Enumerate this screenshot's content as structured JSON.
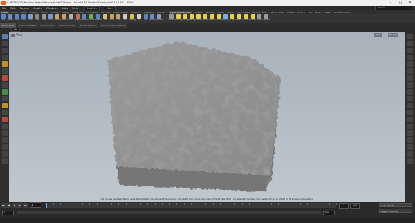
{
  "window": {
    "title": "C:/WORK/GIS/Houdini Projects/bricks/bricks01.hipnc - Houdini FX Limited Commercial 19.5.467 - FyTri",
    "controls": {
      "minimize": "–",
      "maximize": "□",
      "close": "✕"
    }
  },
  "menubar": {
    "items": [
      "File",
      "Edit",
      "Render",
      "Assets",
      "Windows",
      "Labs",
      "Help"
    ],
    "desktop": "Modeler",
    "build": "Main",
    "search_placeholder": "Search"
  },
  "shelf_tabs_left": [
    "Create",
    "Modify",
    "Model",
    "Polygon",
    "Deform",
    "Texture",
    "Rigging",
    "Characters",
    "Constraints",
    "Hair Utils",
    "Guide Process",
    "Terrain FX",
    "Simple FX",
    "Volume"
  ],
  "shelf_tabs_right": [
    "Lights and Cameras",
    "Collisions",
    "Particles",
    "Grains",
    "Vellum",
    "Rigid Bodies",
    "Particle Fluids",
    "Viscous Fluids",
    "Oceans",
    "Pyro FX",
    "FEM",
    "Wires",
    "Crowds",
    "Drive Simulation"
  ],
  "shelf_tools_left": [
    {
      "label": "Box",
      "icon": "box-icon",
      "color": "#5d86c5"
    },
    {
      "label": "Sphere",
      "icon": "sphere-icon",
      "color": "#6b8fc9"
    },
    {
      "label": "Tube",
      "icon": "tube-icon",
      "color": "#5d86c5"
    },
    {
      "label": "Torus",
      "icon": "torus-icon",
      "color": "#5d86c5"
    },
    {
      "label": "Grid",
      "icon": "grid-icon",
      "color": "#7a9ac9"
    },
    {
      "label": "Null",
      "icon": "null-icon",
      "color": "#8a8a8a"
    },
    {
      "label": "Line",
      "icon": "line-icon",
      "color": "#9a9a9a"
    },
    {
      "label": "Circle",
      "icon": "circle-icon",
      "color": "#7a9ac9"
    },
    {
      "label": "Curve Bezier",
      "icon": "curve-icon",
      "color": "#c9a35d"
    },
    {
      "label": "Draw Curve",
      "icon": "draw-curve-icon",
      "color": "#c9a35d"
    },
    {
      "label": "Path",
      "icon": "path-icon",
      "color": "#b0b0b0"
    },
    {
      "label": "Spray Paint",
      "icon": "spray-icon",
      "color": "#c96b5d"
    },
    {
      "label": "Platonic Solids",
      "icon": "platonic-icon",
      "color": "#5d86c5"
    },
    {
      "label": "L-System",
      "icon": "lsystem-icon",
      "color": "#6bb05d"
    },
    {
      "label": "Metaball",
      "icon": "metaball-icon",
      "color": "#5d86c5"
    },
    {
      "label": "File",
      "icon": "file-icon",
      "color": "#d9c07a"
    },
    {
      "label": "Spiral",
      "icon": "spiral-icon",
      "color": "#c9a35d"
    },
    {
      "label": "Helix",
      "icon": "helix-icon",
      "color": "#c9a35d"
    },
    {
      "label": "Font",
      "icon": "font-icon",
      "color": "#cccccc"
    },
    {
      "label": "Lighting",
      "icon": "lighting-icon",
      "color": "#e0c24a"
    },
    {
      "label": "Fill",
      "icon": "fill-icon",
      "color": "#d0d0d0"
    },
    {
      "label": "Skin",
      "icon": "skin-icon",
      "color": "#5d86c5"
    },
    {
      "label": "Smooth",
      "icon": "smooth-icon",
      "color": "#6b8fc9"
    },
    {
      "label": "Geometry",
      "icon": "geometry-icon",
      "color": "#8aa0c0"
    }
  ],
  "shelf_tools_right": [
    {
      "label": "Camera",
      "icon": "camera-icon",
      "color": "#9a9a9a"
    },
    {
      "label": "Point Light",
      "icon": "point-light-icon",
      "color": "#e8d04a"
    },
    {
      "label": "Spot Light",
      "icon": "spot-light-icon",
      "color": "#e8d04a"
    },
    {
      "label": "Area Light",
      "icon": "area-light-icon",
      "color": "#e8d04a"
    },
    {
      "label": "Geometry Light",
      "icon": "geo-light-icon",
      "color": "#e8d04a"
    },
    {
      "label": "Volume Light",
      "icon": "volume-light-icon",
      "color": "#e8d04a"
    },
    {
      "label": "Distant Light",
      "icon": "distant-light-icon",
      "color": "#e8d04a"
    },
    {
      "label": "Environment Light",
      "icon": "env-light-icon",
      "color": "#e8d04a"
    },
    {
      "label": "Sky Light",
      "icon": "sky-light-icon",
      "color": "#7ab0e8"
    },
    {
      "label": "GI Light",
      "icon": "gi-light-icon",
      "color": "#e8d04a"
    },
    {
      "label": "Caustic Light",
      "icon": "caustic-light-icon",
      "color": "#e8d04a"
    },
    {
      "label": "Portal Light",
      "icon": "portal-light-icon",
      "color": "#e8d04a"
    },
    {
      "label": "Ambient Light",
      "icon": "ambient-light-icon",
      "color": "#e8d04a"
    },
    {
      "label": "VR Camera",
      "icon": "vr-camera-icon",
      "color": "#9a9a9a"
    },
    {
      "label": "Switcher",
      "icon": "switcher-icon",
      "color": "#9a9a9a"
    }
  ],
  "pane_tabs": [
    "Scene View",
    "Animation Editor",
    "Render View",
    "Composite View",
    "Motion FX View",
    "Geometry Spreadsheet"
  ],
  "path": {
    "back": "←",
    "forward": "→",
    "node": "obj"
  },
  "viewport": {
    "label": "View",
    "persp_button": "Persp",
    "cam_button": "No cam",
    "status": "Left mouse tumbles. Middle pans. Right dollies. Ctrl+Alt+Left box-zooms. Ctrl+Right box-zooms. Spacebar-Ctrl-Left tilts. Hold L for alternate tumble, dolly, and zoom. M or Alt+M for First Person Navigation."
  },
  "timeline": {
    "buttons": [
      "⏮",
      "◀",
      "⏸",
      "▶",
      "⏭"
    ],
    "current_frame": "1",
    "start_frame": "1",
    "end_frame": "240",
    "end_field_a": "1",
    "end_field_b": "240",
    "key_buttons": [
      "Auto Update",
      "Key All Channels"
    ],
    "realtime_label": "Auto Update"
  },
  "colors": {
    "accent": "#e2631a",
    "viewport_top": "#a8b2bb",
    "viewport_bottom": "#c0c8cf"
  }
}
